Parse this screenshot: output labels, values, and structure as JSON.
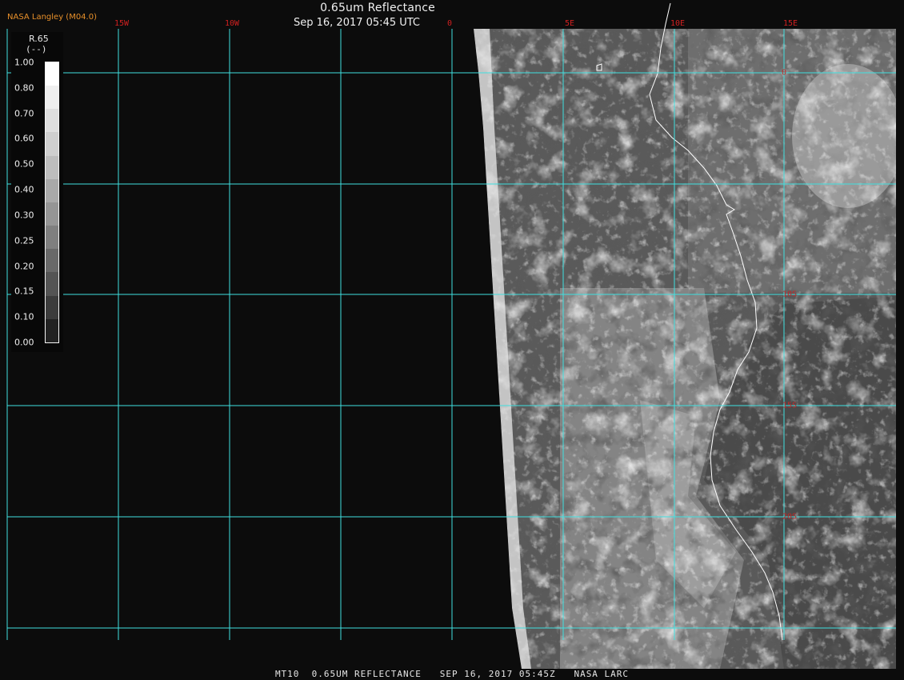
{
  "header": {
    "title": "0.65um Reflectance",
    "datetime": "Sep 16, 2017 05:45 UTC",
    "organization": "NASA Langley (M04.0)"
  },
  "legend": {
    "variable": "R.65",
    "unit": "(--)",
    "ticks": [
      "1.00",
      "0.80",
      "0.70",
      "0.60",
      "0.50",
      "0.40",
      "0.30",
      "0.25",
      "0.20",
      "0.15",
      "0.10",
      "0.00"
    ],
    "ramp_colors": [
      "#ffffff",
      "#efefef",
      "#dfdfdf",
      "#cfcfcf",
      "#bdbdbd",
      "#a9a9a9",
      "#959595",
      "#7f7f7f",
      "#696969",
      "#545454",
      "#3c3c3c",
      "#222222"
    ]
  },
  "grid": {
    "longitude_labels": [
      "15W",
      "10W",
      "0",
      "5E",
      "10E",
      "15E"
    ],
    "latitude_labels": [
      "0",
      "10S",
      "15S",
      "20S"
    ],
    "line_color": "#3fe0e0"
  },
  "footer": {
    "text": "MT10  0.65UM REFLECTANCE   SEP 16, 2017 05:45Z   NASA LARC"
  },
  "colors": {
    "background": "#0c0c0c",
    "coastline": "#ffffff",
    "lon_label": "#d02020",
    "lat_label": "#c02828"
  }
}
